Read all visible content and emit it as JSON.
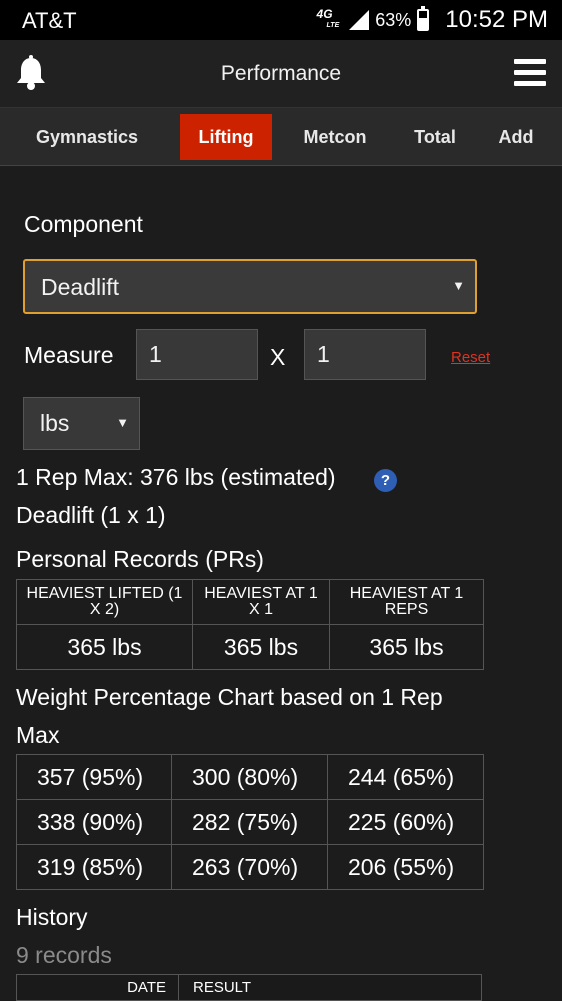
{
  "status_bar": {
    "carrier": "AT&T",
    "network": "4G",
    "network_sub": "LTE",
    "battery_pct": "63%",
    "battery_level": 0.63,
    "time": "10:52 PM"
  },
  "app_bar": {
    "title": "Performance",
    "left_icon": "bell-icon",
    "right_icon": "menu-icon"
  },
  "tabs": [
    {
      "label": "Gymnastics",
      "active": false
    },
    {
      "label": "Lifting",
      "active": true
    },
    {
      "label": "Metcon",
      "active": false
    },
    {
      "label": "Total",
      "active": false
    },
    {
      "label": "Add",
      "active": false
    }
  ],
  "form": {
    "component_label": "Component",
    "component_value": "Deadlift",
    "measure_label": "Measure",
    "measure_sets": "1",
    "measure_x": "X",
    "measure_reps": "1",
    "reset_label": "Reset",
    "unit_value": "lbs"
  },
  "summary": {
    "one_rep_max": "1 Rep Max: 376 lbs (estimated)",
    "info_icon_text": "?",
    "lift_name": "Deadlift (1 x 1)"
  },
  "personal_records": {
    "heading": "Personal Records (PRs)",
    "headers": [
      "HEAVIEST LIFTED (1 X 2)",
      "HEAVIEST AT 1 X 1",
      "HEAVIEST AT 1 REPS"
    ],
    "values": [
      "365 lbs",
      "365 lbs",
      "365 lbs"
    ]
  },
  "weight_chart": {
    "heading_line1": "Weight Percentage Chart based on 1 Rep",
    "heading_line2": "Max",
    "rows": [
      [
        "357 (95%)",
        "300 (80%)",
        "244 (65%)"
      ],
      [
        "338 (90%)",
        "282 (75%)",
        "225 (60%)"
      ],
      [
        "319 (85%)",
        "263 (70%)",
        "206 (55%)"
      ]
    ]
  },
  "history": {
    "heading": "History",
    "count": "9 records",
    "headers": [
      "DATE",
      "RESULT"
    ]
  },
  "colors": {
    "accent": "#cc2200",
    "focus_border": "#e0a030",
    "link": "#dd3322",
    "info": "#2f5fb5"
  }
}
